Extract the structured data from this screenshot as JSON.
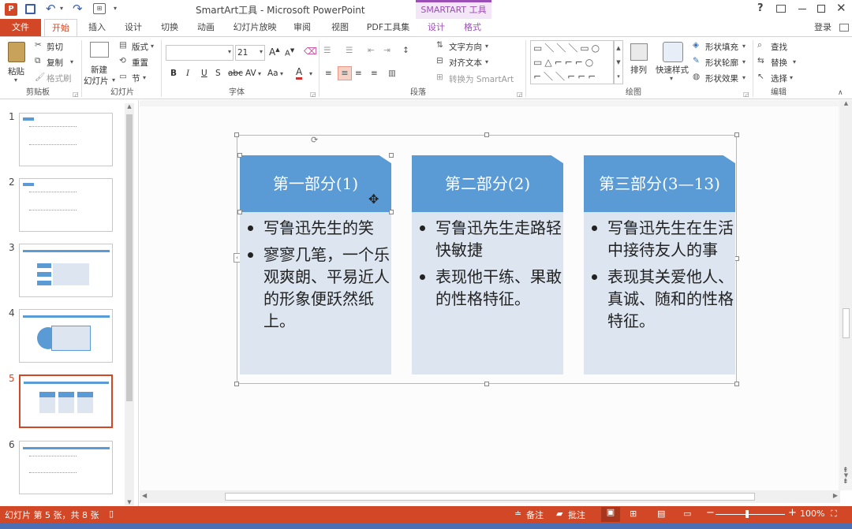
{
  "window": {
    "title": "SmartArt工具 - Microsoft PowerPoint",
    "context_tab_group": "SMARTART 工具",
    "help": "?",
    "login": "登录"
  },
  "tabs": [
    "文件",
    "开始",
    "插入",
    "设计",
    "切换",
    "动画",
    "幻灯片放映",
    "审阅",
    "视图",
    "PDF工具集",
    "设计",
    "格式"
  ],
  "ribbon": {
    "clipboard": {
      "paste": "粘贴",
      "cut": "剪切",
      "copy": "复制",
      "format_painter": "格式刷",
      "label": "剪贴板"
    },
    "slides": {
      "new_slide": "新建",
      "new_slide2": "幻灯片",
      "layout": "版式",
      "reset": "重置",
      "section": "节",
      "label": "幻灯片"
    },
    "font": {
      "font_name": "",
      "font_size": "21",
      "bold": "B",
      "italic": "I",
      "underline": "U",
      "shadow": "S",
      "strike": "abc",
      "spacing": "AV",
      "case": "Aa",
      "color": "A",
      "label": "字体"
    },
    "paragraph": {
      "text_direction": "文字方向",
      "align_text": "对齐文本",
      "convert_smartart": "转换为 SmartArt",
      "label": "段落"
    },
    "drawing": {
      "arrange": "排列",
      "quick_styles": "快速样式",
      "shape_fill": "形状填充",
      "shape_outline": "形状轮廓",
      "shape_effects": "形状效果",
      "label": "绘图"
    },
    "editing": {
      "find": "查找",
      "replace": "替换",
      "select": "选择",
      "label": "编辑"
    }
  },
  "thumbnails": [
    {
      "num": "1",
      "selected": false
    },
    {
      "num": "2",
      "selected": false
    },
    {
      "num": "3",
      "selected": false
    },
    {
      "num": "4",
      "selected": false
    },
    {
      "num": "5",
      "selected": true
    },
    {
      "num": "6",
      "selected": false
    }
  ],
  "slide": {
    "columns": [
      {
        "header": "第一部分(1)",
        "bullets": [
          "写鲁迅先生的笑",
          "寥寥几笔，一个乐观爽朗、平易近人的形象便跃然纸上。"
        ]
      },
      {
        "header": "第二部分(2)",
        "bullets": [
          "写鲁迅先生走路轻快敏捷",
          "表现他干练、果敢的性格特征。"
        ]
      },
      {
        "header": "第三部分(3—13)",
        "bullets": [
          "写鲁迅先生在生活中接待友人的事",
          "表现其关爱他人、真诚、随和的性格特征。"
        ]
      }
    ]
  },
  "status": {
    "slide_info": "幻灯片 第 5 张，共 8 张",
    "notes": "备注",
    "comments": "批注",
    "zoom": "100%"
  },
  "colors": {
    "accent": "#d24726",
    "smartart_header": "#5b9bd5",
    "smartart_body": "#dde5f1",
    "context_tab": "#9b4fb5"
  }
}
